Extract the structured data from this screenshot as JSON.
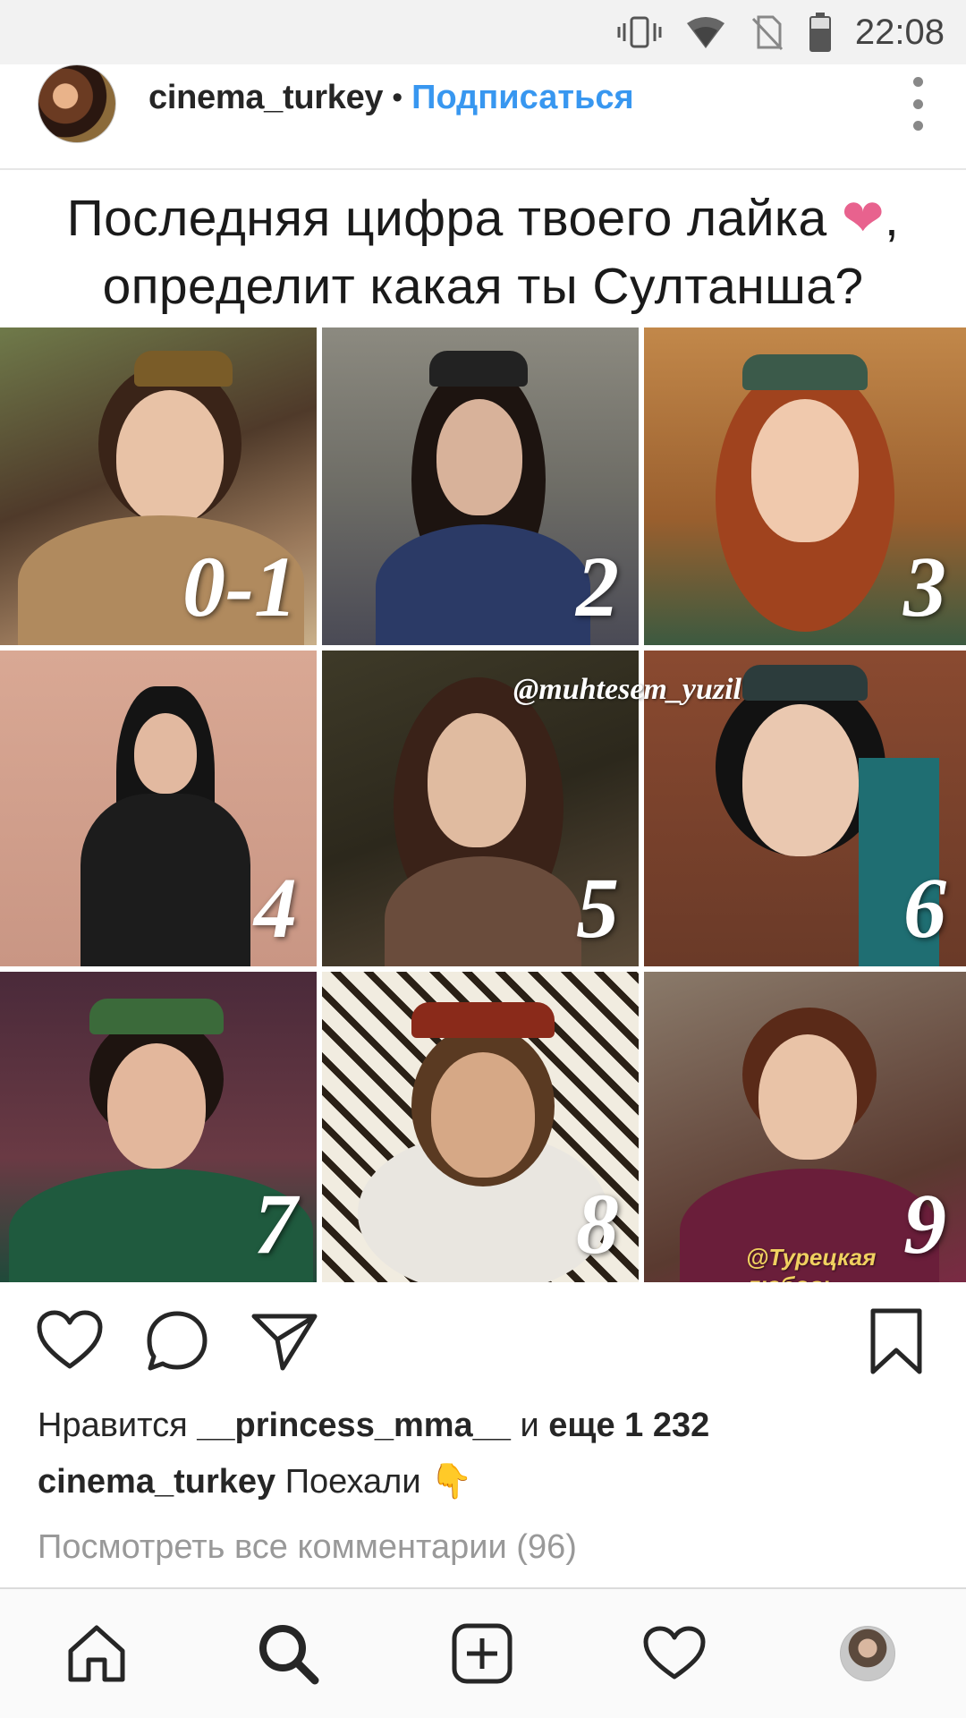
{
  "status_bar": {
    "time": "22:08",
    "icons": [
      "vibrate-icon",
      "wifi-icon",
      "no-sim-icon",
      "battery-icon"
    ]
  },
  "post": {
    "username": "cinema_turkey",
    "separator": "•",
    "follow_label": "Подписаться",
    "image": {
      "title_line1": "Последняя цифра твоего лайка",
      "title_heart": "❤",
      "title_comma": ",",
      "title_line2": "определит какая ты Султанша?",
      "tiles": [
        {
          "label": "0-1"
        },
        {
          "label": "2"
        },
        {
          "label": "3"
        },
        {
          "label": "4"
        },
        {
          "label": "5"
        },
        {
          "label": "6"
        },
        {
          "label": "7"
        },
        {
          "label": "8"
        },
        {
          "label": "9"
        }
      ],
      "watermark_top": "@muhtesem_yuzil",
      "watermark_bottom": "@Турецкая любовь"
    },
    "likes": {
      "prefix": "Нравится",
      "user": "__princess_mma__",
      "conj": "и",
      "more": "еще 1 232"
    },
    "caption": {
      "username": "cinema_turkey",
      "text": "Поехали",
      "emoji": "👇"
    },
    "view_comments": "Посмотреть все комментарии (96)"
  },
  "nav": {
    "items": [
      "home-icon",
      "search-icon",
      "add-post-icon",
      "activity-heart-icon",
      "profile-avatar"
    ]
  },
  "colors": {
    "accent": "#3897f0",
    "heart": "#e8628e",
    "muted": "#999999"
  }
}
